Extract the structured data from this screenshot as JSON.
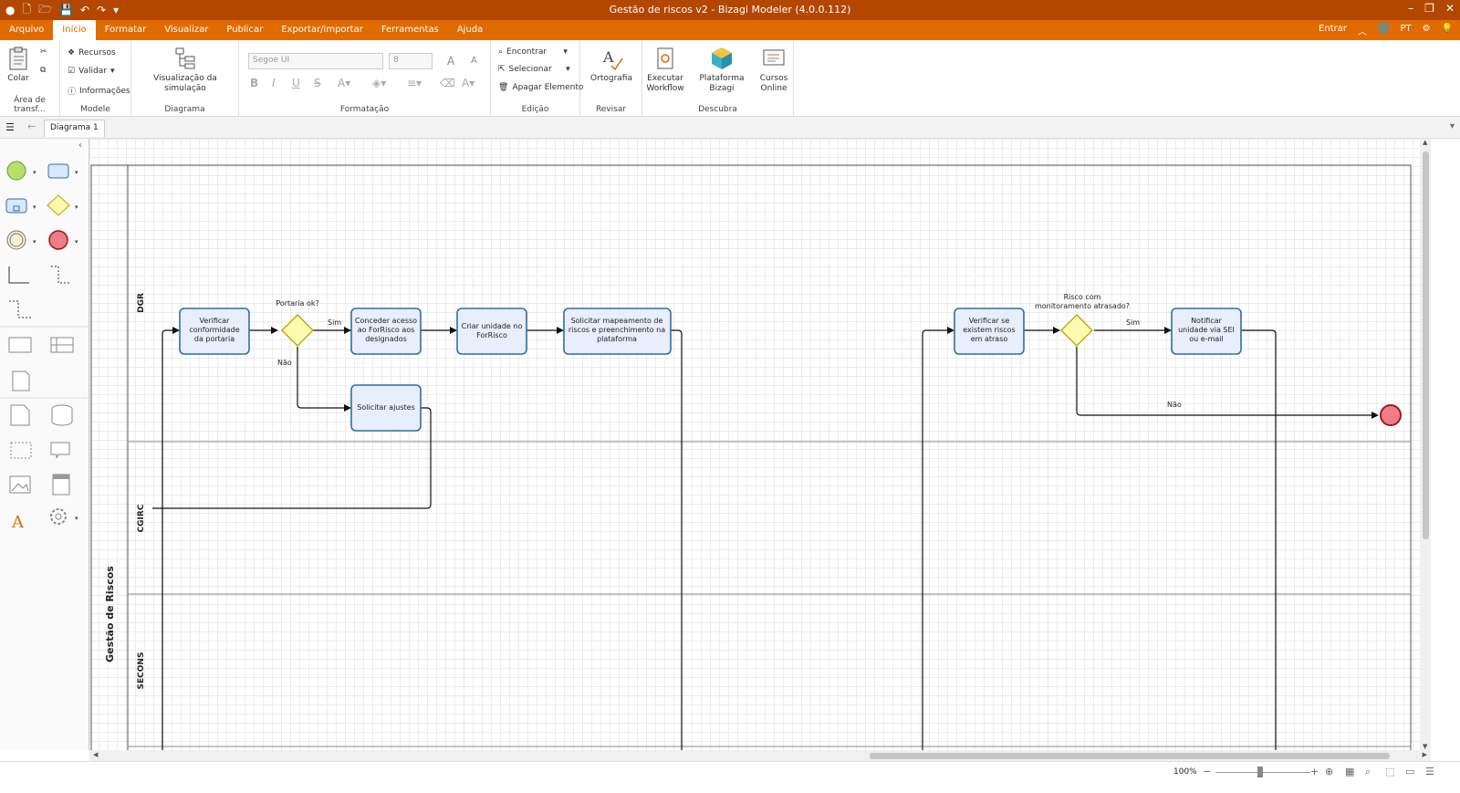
{
  "window": {
    "title": "Gestão de riscos v2 - Bizagi Modeler (4.0.0.112)"
  },
  "menu": {
    "tabs": [
      "Arquivo",
      "Início",
      "Formatar",
      "Visualizar",
      "Publicar",
      "Exportar/importar",
      "Ferramentas",
      "Ajuda"
    ],
    "active": "Início",
    "signin": "Entrar",
    "language": "PT"
  },
  "ribbon": {
    "clipboard": {
      "paste": "Colar",
      "group": "Área de transf..."
    },
    "model": {
      "resources": "Recursos",
      "validate": "Validar",
      "info": "Informações",
      "group": "Modele"
    },
    "diagram": {
      "simulation": "Visualização da simulação",
      "group": "Diagrama"
    },
    "format": {
      "font": "Segoe UI",
      "size": "8",
      "group": "Formatação"
    },
    "edit": {
      "find": "Encontrar",
      "select": "Selecionar",
      "delete": "Apagar Elemento",
      "group": "Edição"
    },
    "review": {
      "spelling": "Ortografia",
      "group": "Revisar"
    },
    "discover": {
      "run_workflow_1": "Executar",
      "run_workflow_2": "Workflow",
      "platform": "Plataforma Bizagi",
      "courses_1": "Cursos",
      "courses_2": "Online",
      "group": "Descubra"
    }
  },
  "doc_tab": "Diagrama 1",
  "diagram": {
    "pool": "Gestão de Riscos",
    "lanes": [
      "DGR",
      "CGIRC",
      "SECONS"
    ],
    "tasks": {
      "t1": [
        "Verificar",
        "conformidade",
        "da portaria"
      ],
      "t2": [
        "Conceder acesso",
        "ao ForRisco aos",
        "designados"
      ],
      "t3": [
        "Criar unidade no",
        "ForRisco"
      ],
      "t4": [
        "Solicitar mapeamento de",
        "riscos e preenchimento na",
        "plataforma"
      ],
      "t5": [
        "Solicitar ajustes"
      ],
      "t6": [
        "Verificar se",
        "existem riscos",
        "em atraso"
      ],
      "t7": [
        "Notificar",
        "unidade via SEI",
        "ou e-mail"
      ]
    },
    "gateways": {
      "g1": "Portaria ok?",
      "g2_1": "Risco com",
      "g2_2": "monitoramento atrasado?"
    },
    "flow_labels": {
      "g1_yes": "Sim",
      "g1_no": "Não",
      "g2_yes": "Sim",
      "g2_no": "Não"
    }
  },
  "status": {
    "zoom": "100%"
  },
  "colors": {
    "title_bar": "#b34700",
    "menu_bar": "#e06b00",
    "task_fill": "#e8eefb",
    "task_stroke": "#2d6fa8",
    "gateway_fill": "#fdfbb0",
    "end_fill": "#ee7d84"
  }
}
